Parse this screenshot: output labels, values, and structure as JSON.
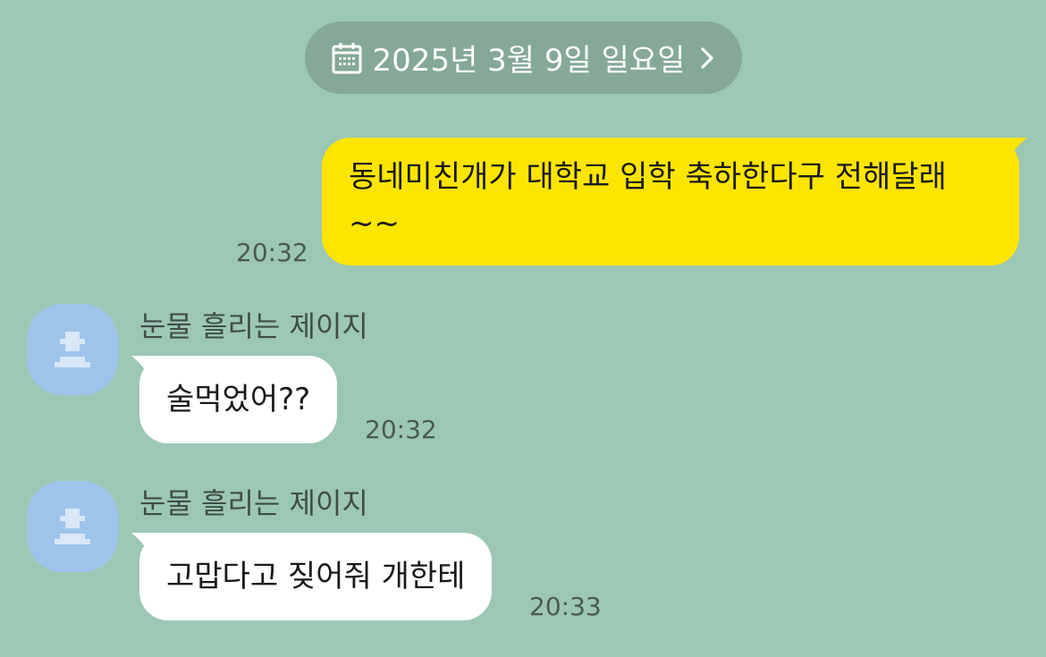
{
  "date_header": {
    "label": "2025년 3월 9일 일요일"
  },
  "messages": [
    {
      "sender": "me",
      "text": "동네미친개가 대학교 입학 축하한다구 전해달래\n~~",
      "time": "20:32"
    },
    {
      "sender": "눈물 흘리는 제이지",
      "text": "술먹었어??",
      "time": "20:32"
    },
    {
      "sender": "눈물 흘리는 제이지",
      "text": "고맙다고 짖어줘 개한테",
      "time": "20:33"
    }
  ],
  "colors": {
    "background": "#9dc7b5",
    "my_bubble": "#fee500",
    "their_bubble": "#ffffff",
    "avatar": "#9fc4eb",
    "date_pill": "#85a898"
  },
  "icons": {
    "date": "calendar-icon",
    "date_action": "chevron-right-icon",
    "avatar": "default-profile-icon"
  }
}
